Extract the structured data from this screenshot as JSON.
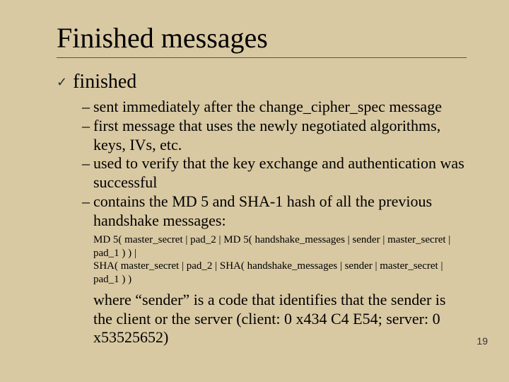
{
  "title": "Finished messages",
  "level1": {
    "bullet_glyph": "✓",
    "text": "finished"
  },
  "level2": [
    "sent immediately after the change_cipher_spec message",
    "first message that uses the newly negotiated algorithms, keys, IVs, etc.",
    "used to verify that the key exchange and authentication was successful",
    "contains the MD 5 and SHA-1 hash of all the previous handshake messages:"
  ],
  "code": {
    "line1": "MD 5( master_secret | pad_2 | MD 5( handshake_messages | sender | master_secret | pad_1 ) ) |",
    "line2": "SHA( master_secret | pad_2 | SHA( handshake_messages | sender | master_secret | pad_1 ) )"
  },
  "closing": "where “sender” is a code that identifies that the sender is the client or the server (client: 0 x434 C4 E54; server: 0 x53525652)",
  "page_number": "19"
}
